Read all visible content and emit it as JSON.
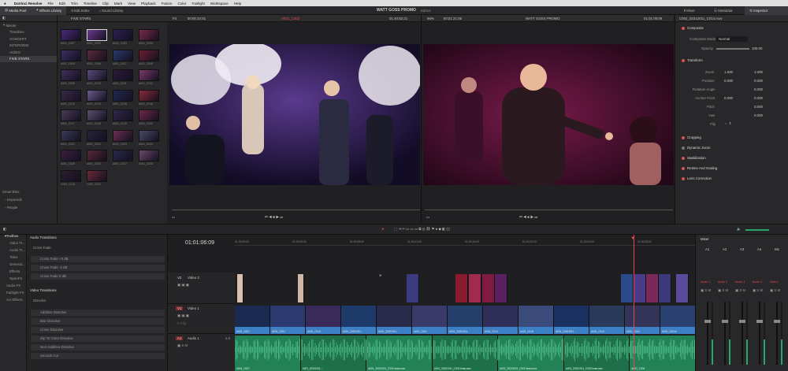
{
  "menu": {
    "app": "DaVinci Resolve",
    "items": [
      "File",
      "Edit",
      "Trim",
      "Timeline",
      "Clip",
      "Mark",
      "View",
      "Playback",
      "Fusion",
      "Color",
      "Fairlight",
      "Workspace",
      "Help"
    ]
  },
  "toolbar": {
    "media_pool": "Media Pool",
    "effects_library": "Effects Library",
    "edit_index": "Edit Index",
    "sound_library": "Sound Library",
    "title": "WATT GOSS PROMO",
    "title_status": "Edited",
    "mixer": "Mixer",
    "metadata": "Metadata",
    "inspector": "Inspector"
  },
  "bins": {
    "header": "FIVE STARS",
    "master": "Master",
    "items": [
      "Timelines",
      "CONCERT",
      "INTERVIEW",
      "AUDIO",
      "FIVE STARS"
    ],
    "selected": "FIVE STARS",
    "smart_bins": "Smart Bins",
    "smart_items": [
      "Keywords",
      "People"
    ]
  },
  "clips": [
    "A001_C007",
    "A001_C002",
    "A001_C003",
    "A001_C004",
    "A001_C005",
    "A001_C006",
    "A001_C007",
    "A001_C008",
    "A001_C009",
    "A001_C010",
    "A001_C011",
    "A001_C012",
    "A001_C013",
    "A001_C014",
    "A001_C015",
    "A001_C016",
    "A001_C017",
    "A001_C018",
    "A001_C019",
    "A001_C020",
    "A001_C021",
    "A001_C022",
    "A001_C023",
    "A001_C024",
    "A001_C025",
    "A001_C026",
    "A001_C027",
    "A001_C028",
    "C001_C013",
    "C002_C012"
  ],
  "source": {
    "zoom": "Fit",
    "timecode": "00:00:10:01",
    "clip": "A001_C002",
    "duration_tc": "01:40:52:21",
    "zoom2": "96%",
    "tc2": "00:01:21:05",
    "timeline_name": "WATT GOSS PROMO",
    "rec_tc": "01:01:06:09"
  },
  "timeline": {
    "timecode": "01:01:06:09",
    "ruler": [
      "01:00:00:00",
      "01:00:04:00",
      "01:00:08:00",
      "01:00:12:00",
      "01:00:16:00",
      "01:00:20:00",
      "01:00:24:00",
      "01:00:28:00",
      "01:00:32:00"
    ],
    "tracks": [
      {
        "id": "V2",
        "name": "Video 2"
      },
      {
        "id": "V1",
        "name": "Video 1"
      },
      {
        "id": "A1",
        "name": "Audio 1",
        "level": "2.0"
      }
    ],
    "clip_count": "0 Clip",
    "v1_clips": [
      "A001_C007",
      "A001_C001",
      "A001_C014",
      "A001_20201911...",
      "A001_20201911...",
      "A001_C001",
      "A001_20201911...",
      "A001_C014",
      "A001_C015",
      "A001_20201911...",
      "A001_C014",
      "A001_C004",
      "A001_C0016"
    ],
    "a1_clips": [
      "A001_C007",
      "A001_20201911...",
      "A001_20201911_C002.braw.mov",
      "A001_20201911_C002.braw.mov",
      "A001_20201911_C002.braw.mov",
      "A001_20201911_C002.braw.mov",
      "A001_C004"
    ]
  },
  "effects": {
    "toolbox": "Toolbox",
    "categories": [
      "Video Tr...",
      "Audio Tr...",
      "Titles",
      "Generat...",
      "Effects",
      "OpenFX",
      "Audio FX",
      "Fairlight FX",
      "AU Effects"
    ],
    "audio_header": "Audio Transitions",
    "cross_fade": "Cross Fade",
    "fades": [
      "Cross Fade +3 dB",
      "Cross Fade -3 dB",
      "Cross Fade 0 dB"
    ],
    "video_header": "Video Transitions",
    "dissolve": "Dissolve",
    "dissolves": [
      "Additive Dissolve",
      "Blur Dissolve",
      "Cross Dissolve",
      "Dip To Color Dissolve",
      "Non-Additive Dissolve",
      "Smooth Cut"
    ]
  },
  "inspector": {
    "clip": "C002_03312011_C014.mov",
    "composite": "Composite",
    "composite_mode_label": "Composite Mode",
    "composite_mode": "Normal",
    "opacity_label": "Opacity",
    "opacity": "100.00",
    "transform": "Transform",
    "zoom": "Zoom",
    "zoom_x": "1.000",
    "zoom_y": "1.000",
    "position": "Position",
    "pos_x": "0.000",
    "pos_y": "0.000",
    "rotation": "Rotation Angle",
    "rot": "0.000",
    "anchor": "Anchor Point",
    "anc_x": "0.000",
    "anc_y": "0.000",
    "pitch": "Pitch",
    "pitch_v": "0.000",
    "yaw": "Yaw",
    "yaw_v": "0.000",
    "flip": "Flip",
    "sections": [
      "Cropping",
      "Dynamic Zoom",
      "Stabilization",
      "Retime And Scaling",
      "Lens Correction"
    ]
  },
  "mixer": {
    "title": "Mixer",
    "channels": [
      "A1",
      "A2",
      "A3",
      "A4",
      "M1"
    ],
    "buses": [
      "Audio 1",
      "Audio 2",
      "Audio 3",
      "Audio 4",
      "Main 1"
    ]
  },
  "colors": {
    "accent": "#e8494f",
    "audio": "#2aa56a",
    "video_clip": "#3b7fc4",
    "bg": "#1e1e20"
  }
}
